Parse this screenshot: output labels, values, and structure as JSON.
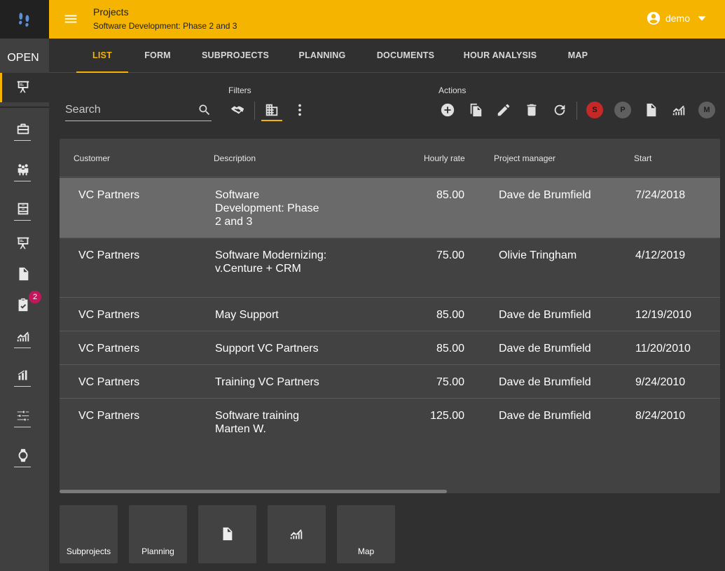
{
  "app": {
    "logo_icon": "footprints-logo",
    "open_label": "OPEN"
  },
  "rail": {
    "items": [
      {
        "icon": "project-presentation-icon",
        "active": true
      },
      {
        "icon": "briefcase-icon"
      },
      {
        "icon": "people-icon"
      },
      {
        "icon": "file-cabinet-icon"
      },
      {
        "icon": "project-presentation-icon"
      },
      {
        "icon": "document-icon"
      },
      {
        "icon": "clipboard-check-icon",
        "badge": "2"
      },
      {
        "icon": "trending-chart-icon"
      },
      {
        "icon": "bar-chart-icon"
      },
      {
        "icon": "sliders-icon"
      },
      {
        "icon": "watch-icon"
      }
    ]
  },
  "header": {
    "title": "Projects",
    "subtitle": "Software Development: Phase 2 and 3",
    "user": "demo"
  },
  "tabs": [
    {
      "label": "LIST",
      "active": true
    },
    {
      "label": "FORM"
    },
    {
      "label": "SUBPROJECTS"
    },
    {
      "label": "PLANNING"
    },
    {
      "label": "DOCUMENTS"
    },
    {
      "label": "HOUR ANALYSIS"
    },
    {
      "label": "MAP"
    }
  ],
  "toolbar": {
    "search_placeholder": "Search",
    "filters_label": "Filters",
    "actions_label": "Actions",
    "status_circles": [
      {
        "letter": "S",
        "color": "#c62828"
      },
      {
        "letter": "P",
        "color": "#5f5f5f"
      },
      {
        "letter": "M",
        "color": "#5f5f5f"
      }
    ]
  },
  "table": {
    "columns": [
      "Customer",
      "Description",
      "Hourly rate",
      "Project manager",
      "Start"
    ],
    "rows": [
      {
        "customer": "VC Partners",
        "description": "Software Development: Phase 2 and 3",
        "rate": "85.00",
        "manager": "Dave de Brumfield",
        "start": "7/24/2018",
        "selected": true
      },
      {
        "customer": "VC Partners",
        "description": "Software Modernizing: v.Centure + CRM",
        "rate": "75.00",
        "manager": "Olivie Tringham",
        "start": "4/12/2019"
      },
      {
        "customer": "VC Partners",
        "description": "May Support",
        "rate": "85.00",
        "manager": "Dave de Brumfield",
        "start": "12/19/2010"
      },
      {
        "customer": "VC Partners",
        "description": "Support VC Partners",
        "rate": "85.00",
        "manager": "Dave de Brumfield",
        "start": "11/20/2010"
      },
      {
        "customer": "VC Partners",
        "description": "Training VC Partners",
        "rate": "75.00",
        "manager": "Dave de Brumfield",
        "start": "9/24/2010"
      },
      {
        "customer": "VC Partners",
        "description": "Software training Marten W.",
        "rate": "125.00",
        "manager": "Dave de Brumfield",
        "start": "8/24/2010"
      }
    ]
  },
  "tiles": [
    {
      "label": "Subprojects"
    },
    {
      "label": "Planning"
    },
    {
      "label": "",
      "icon": "document-icon"
    },
    {
      "label": "",
      "icon": "trending-chart-icon"
    },
    {
      "label": "Map"
    }
  ],
  "colors": {
    "accent": "#f4b400",
    "background": "#303030",
    "panel": "#424242",
    "selected_row": "#6a6a6a"
  }
}
